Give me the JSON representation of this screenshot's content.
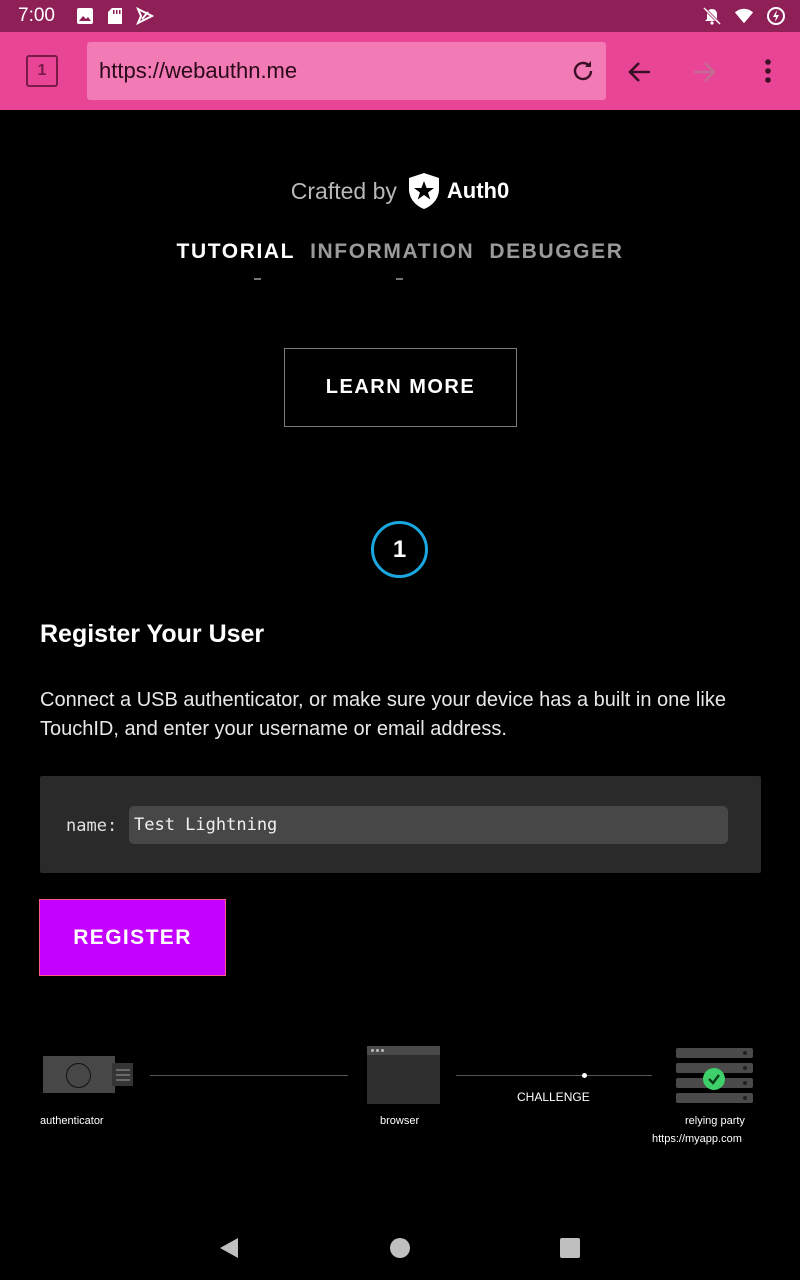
{
  "status_bar": {
    "time": "7:00",
    "left_icons": [
      "image-icon",
      "sd-card-icon",
      "play-store-icon"
    ],
    "right_icons": [
      "notifications-off-icon",
      "wifi-icon",
      "battery-charging-icon"
    ]
  },
  "browser": {
    "tab_count": "1",
    "url": "https://webauthn.me"
  },
  "header": {
    "crafted_by": "Crafted by",
    "brand": "Auth0"
  },
  "nav": {
    "items": [
      "TUTORIAL",
      "INFORMATION",
      "DEBUGGER"
    ],
    "active": "TUTORIAL"
  },
  "learn_more_label": "LEARN MORE",
  "step": {
    "number": "1",
    "title": "Register Your User",
    "description": "Connect a USB authenticator, or make sure your device has a built in one like TouchID, and enter your username or email address."
  },
  "form": {
    "label": "name:",
    "value": "Test Lightning"
  },
  "register_label": "REGISTER",
  "diagram": {
    "authenticator": "authenticator",
    "browser": "browser",
    "challenge": "CHALLENGE",
    "relying_party": "relying party",
    "relying_party_url": "https://myapp.com"
  },
  "colors": {
    "status_bar": "#8f2057",
    "toolbar": "#e94597",
    "accent_circle": "#1aa7e0",
    "register_button": "#c400ff",
    "check_green": "#3ed06a"
  }
}
